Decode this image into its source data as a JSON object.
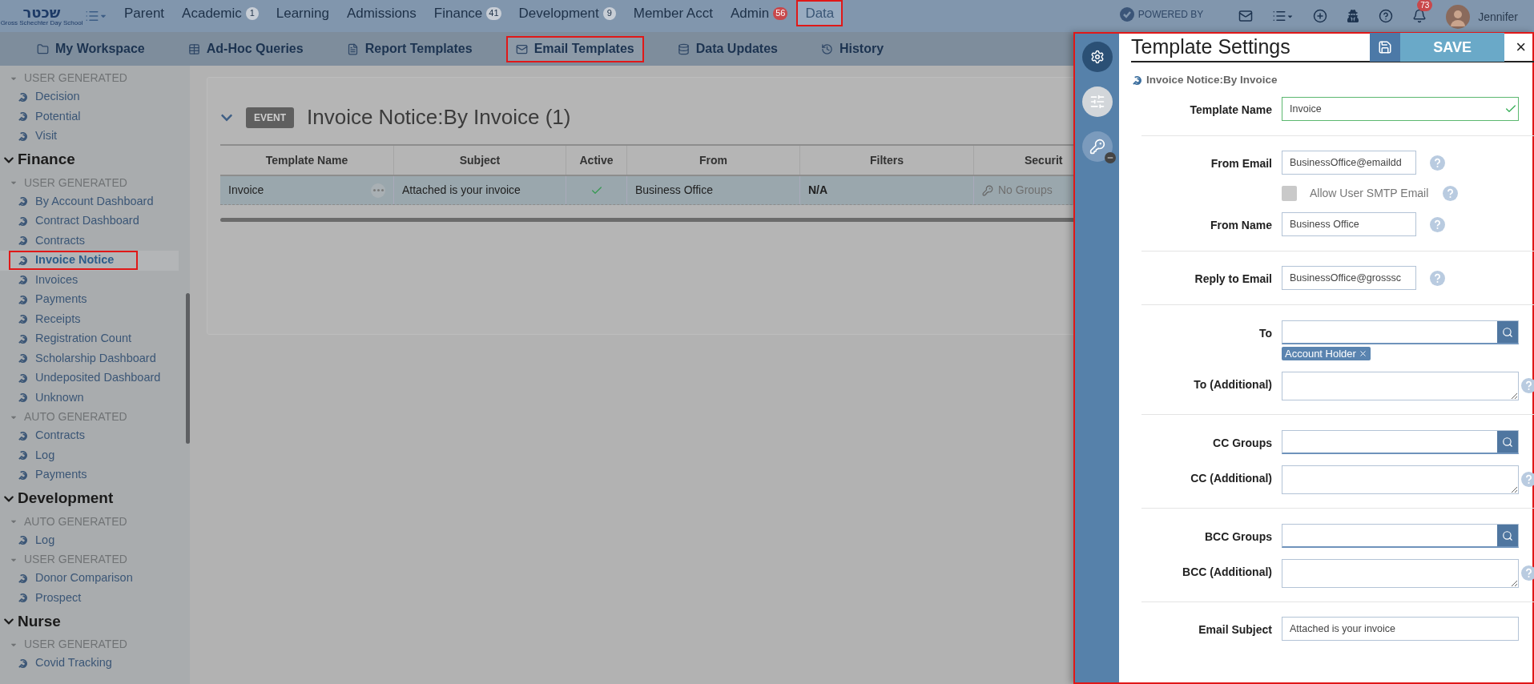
{
  "top_nav": {
    "logo": {
      "title": "שכטר",
      "subtitle": "Gross Schechter Day School"
    },
    "items": [
      {
        "label": "Parent",
        "selected": false,
        "highlighted": false
      },
      {
        "label": "Academic",
        "badge": "1",
        "badge_alert": false,
        "selected": false,
        "highlighted": false
      },
      {
        "label": "Learning",
        "selected": false,
        "highlighted": false
      },
      {
        "label": "Admissions",
        "selected": false,
        "highlighted": false
      },
      {
        "label": "Finance",
        "badge": "41",
        "badge_alert": false,
        "selected": false,
        "highlighted": false
      },
      {
        "label": "Development",
        "badge": "9",
        "badge_alert": false,
        "selected": false,
        "highlighted": false
      },
      {
        "label": "Member Acct",
        "selected": false,
        "highlighted": false
      },
      {
        "label": "Admin",
        "badge": "56",
        "badge_alert": true,
        "selected": false,
        "highlighted": false
      },
      {
        "label": "Data",
        "selected": true,
        "highlighted": true
      }
    ],
    "powered_by": "POWERED BY",
    "notification_count": "73",
    "user_name": "Jennifer"
  },
  "sub_tabs": [
    {
      "label": "My Workspace",
      "selected": false,
      "highlighted": false
    },
    {
      "label": "Ad-Hoc Queries",
      "selected": false,
      "highlighted": false
    },
    {
      "label": "Report Templates",
      "selected": false,
      "highlighted": false
    },
    {
      "label": "Email Templates",
      "selected": true,
      "highlighted": true
    },
    {
      "label": "Data Updates",
      "selected": false,
      "highlighted": false
    },
    {
      "label": "History",
      "selected": false,
      "highlighted": false
    }
  ],
  "sidebar": {
    "sections": [
      {
        "groups": [
          {
            "label": "USER GENERATED",
            "expanded": true,
            "items": [
              {
                "label": "Decision",
                "selected": false,
                "highlighted": false
              },
              {
                "label": "Potential",
                "selected": false,
                "highlighted": false
              },
              {
                "label": "Visit",
                "selected": false,
                "highlighted": false
              }
            ]
          }
        ]
      },
      {
        "title": "Finance",
        "expanded": true,
        "groups": [
          {
            "label": "USER GENERATED",
            "expanded": true,
            "items": [
              {
                "label": "By Account Dashboard",
                "selected": false,
                "highlighted": false
              },
              {
                "label": "Contract Dashboard",
                "selected": false,
                "highlighted": false
              },
              {
                "label": "Contracts",
                "selected": false,
                "highlighted": false
              },
              {
                "label": "Invoice Notice",
                "selected": true,
                "highlighted": true
              },
              {
                "label": "Invoices",
                "selected": false,
                "highlighted": false
              },
              {
                "label": "Payments",
                "selected": false,
                "highlighted": false
              },
              {
                "label": "Receipts",
                "selected": false,
                "highlighted": false
              },
              {
                "label": "Registration Count",
                "selected": false,
                "highlighted": false
              },
              {
                "label": "Scholarship Dashboard",
                "selected": false,
                "highlighted": false
              },
              {
                "label": "Undeposited Dashboard",
                "selected": false,
                "highlighted": false
              },
              {
                "label": "Unknown",
                "selected": false,
                "highlighted": false
              }
            ]
          },
          {
            "label": "AUTO GENERATED",
            "expanded": true,
            "items": [
              {
                "label": "Contracts",
                "selected": false,
                "highlighted": false
              },
              {
                "label": "Log",
                "selected": false,
                "highlighted": false
              },
              {
                "label": "Payments",
                "selected": false,
                "highlighted": false
              }
            ]
          }
        ]
      },
      {
        "title": "Development",
        "expanded": true,
        "groups": [
          {
            "label": "AUTO GENERATED",
            "expanded": true,
            "items": [
              {
                "label": "Log",
                "selected": false,
                "highlighted": false
              }
            ]
          },
          {
            "label": "USER GENERATED",
            "expanded": true,
            "items": [
              {
                "label": "Donor Comparison",
                "selected": false,
                "highlighted": false
              },
              {
                "label": "Prospect",
                "selected": false,
                "highlighted": false
              }
            ]
          }
        ]
      },
      {
        "title": "Nurse",
        "expanded": true,
        "groups": [
          {
            "label": "USER GENERATED",
            "expanded": true,
            "items": [
              {
                "label": "Covid Tracking",
                "selected": false,
                "highlighted": false
              }
            ]
          }
        ]
      }
    ]
  },
  "event_card": {
    "badge": "EVENT",
    "title": "Invoice Notice:By Invoice (1)",
    "expanded": true,
    "table": {
      "columns": [
        "Template Name",
        "Subject",
        "Active",
        "From",
        "Filters",
        "Securit"
      ],
      "rows": [
        {
          "template_name": "Invoice",
          "subject": "Attached is your invoice",
          "active": true,
          "from": "Business Office",
          "filters": "N/A",
          "security": "No Groups",
          "selected": true
        }
      ]
    }
  },
  "panel": {
    "title": "Template Settings",
    "save_label": "SAVE",
    "close": "×",
    "subtitle": "Invoice Notice:By Invoice",
    "highlighted": true,
    "sections": [
      {
        "fields": [
          {
            "kind": "text",
            "label": "Template Name",
            "value": "Invoice",
            "valid": true,
            "help": false
          }
        ]
      },
      {
        "fields": [
          {
            "kind": "text",
            "label": "From Email",
            "value": "BusinessOffice@emaildd",
            "valid": false,
            "help": true
          },
          {
            "kind": "checkbox",
            "label": "Allow User SMTP Email",
            "checked": false,
            "disabled": true,
            "help": true
          },
          {
            "kind": "text",
            "label": "From Name",
            "value": "Business Office",
            "valid": false,
            "help": true
          }
        ]
      },
      {
        "fields": [
          {
            "kind": "text",
            "label": "Reply to Email",
            "value": "BusinessOffice@grosssc",
            "valid": false,
            "help": true
          }
        ]
      },
      {
        "fields": [
          {
            "kind": "lookup",
            "label": "To",
            "chips": [
              "Account Holder"
            ]
          },
          {
            "kind": "textarea",
            "label": "To (Additional)",
            "help": true
          }
        ]
      },
      {
        "fields": [
          {
            "kind": "lookup",
            "label": "CC Groups"
          },
          {
            "kind": "textarea",
            "label": "CC (Additional)",
            "help": true
          }
        ]
      },
      {
        "fields": [
          {
            "kind": "lookup",
            "label": "BCC Groups"
          },
          {
            "kind": "textarea",
            "label": "BCC (Additional)",
            "help": true
          }
        ]
      },
      {
        "fields": [
          {
            "kind": "text",
            "label": "Email Subject",
            "value": "Attached is your invoice",
            "valid": false,
            "help": false
          }
        ]
      }
    ]
  }
}
